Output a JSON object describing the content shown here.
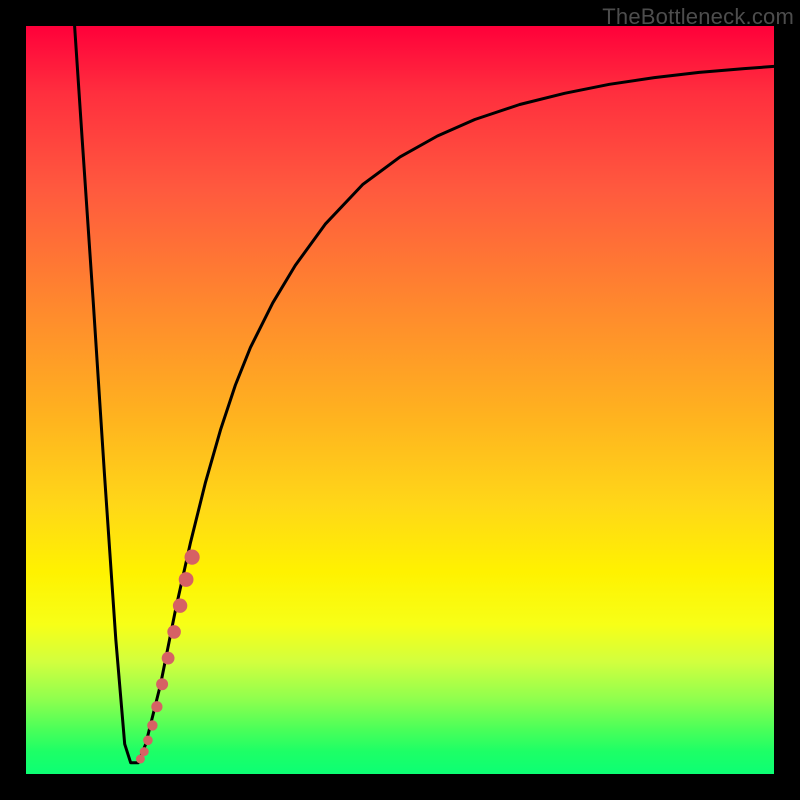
{
  "watermark": "TheBottleneck.com",
  "colors": {
    "frame": "#000000",
    "curve": "#000000",
    "marker": "#d66164"
  },
  "chart_data": {
    "type": "line",
    "title": "",
    "xlabel": "",
    "ylabel": "",
    "xlim": [
      0,
      100
    ],
    "ylim": [
      0,
      100
    ],
    "series": [
      {
        "name": "curve",
        "x": [
          6.5,
          7.5,
          9,
          10.5,
          12,
          13.2,
          14,
          15,
          16,
          18,
          20,
          22,
          24,
          26,
          28,
          30,
          33,
          36,
          40,
          45,
          50,
          55,
          60,
          66,
          72,
          78,
          84,
          90,
          96,
          100
        ],
        "y": [
          100,
          85,
          63,
          40,
          18,
          4,
          1.5,
          1.5,
          4,
          12,
          22,
          31,
          39,
          46,
          52,
          57,
          63,
          68,
          73.5,
          78.8,
          82.5,
          85.3,
          87.5,
          89.5,
          91,
          92.2,
          93.1,
          93.8,
          94.3,
          94.6
        ]
      }
    ],
    "markers": {
      "name": "highlight-segment",
      "color": "#d66164",
      "points": [
        {
          "x": 15.3,
          "y": 2.0,
          "r": 4.5
        },
        {
          "x": 15.8,
          "y": 3.0,
          "r": 4.5
        },
        {
          "x": 16.3,
          "y": 4.5,
          "r": 4.8
        },
        {
          "x": 16.9,
          "y": 6.5,
          "r": 5.2
        },
        {
          "x": 17.5,
          "y": 9.0,
          "r": 5.6
        },
        {
          "x": 18.2,
          "y": 12.0,
          "r": 6.0
        },
        {
          "x": 19.0,
          "y": 15.5,
          "r": 6.4
        },
        {
          "x": 19.8,
          "y": 19.0,
          "r": 6.8
        },
        {
          "x": 20.6,
          "y": 22.5,
          "r": 7.2
        },
        {
          "x": 21.4,
          "y": 26.0,
          "r": 7.4
        },
        {
          "x": 22.2,
          "y": 29.0,
          "r": 7.6
        }
      ]
    }
  }
}
